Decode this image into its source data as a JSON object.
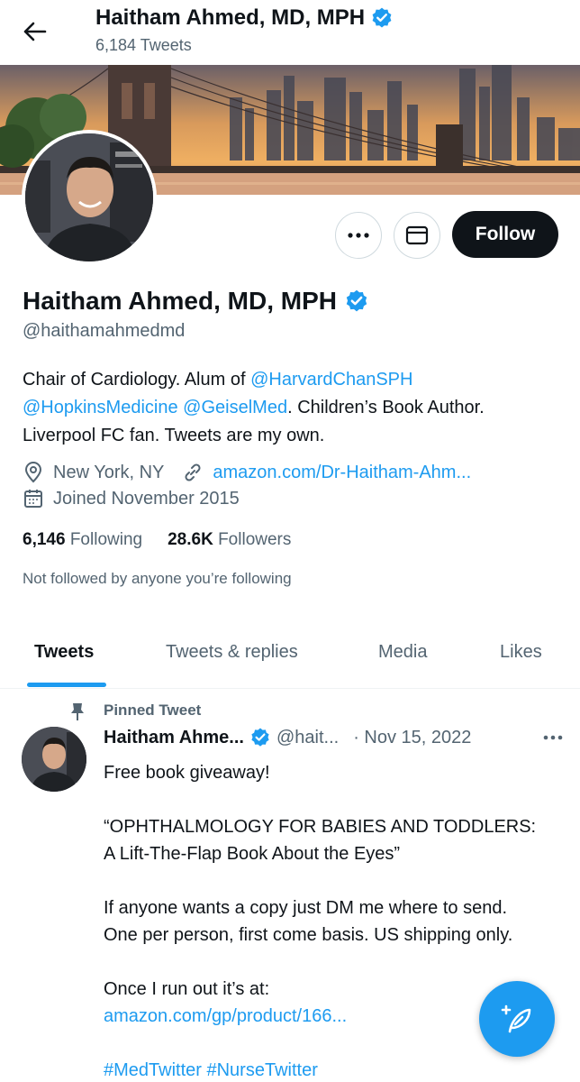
{
  "header": {
    "name": "Haitham Ahmed, MD, MPH",
    "tweet_count": "6,184 Tweets"
  },
  "profile": {
    "name": "Haitham Ahmed, MD, MPH",
    "handle": "@haithamahmedmd",
    "follow_label": "Follow",
    "bio": {
      "part1": "Chair of Cardiology. Alum of ",
      "mention1": "@HarvardChanSPH",
      "mention2": "@HopkinsMedicine",
      "mention3": "@GeiselMed",
      "part2": ". Children’s Book Author.",
      "part3": "Liverpool FC fan. Tweets are my own."
    },
    "location": "New York, NY",
    "website": "amazon.com/Dr-Haitham-Ahm...",
    "joined": "Joined November 2015",
    "following_count": "6,146",
    "following_label": "Following",
    "followers_count": "28.6K",
    "followers_label": "Followers",
    "not_followed": "Not followed by anyone you’re following"
  },
  "tabs": [
    "Tweets",
    "Tweets & replies",
    "Media",
    "Likes"
  ],
  "tweet": {
    "pinned_label": "Pinned Tweet",
    "author": "Haitham Ahme...",
    "handle": "@hait...",
    "date": "· Nov 15, 2022",
    "line1": "Free book giveaway!",
    "line2a": "“OPHTHALMOLOGY FOR BABIES AND TODDLERS:",
    "line2b": "A Lift-The-Flap Book About the Eyes”",
    "line3a": "If anyone wants a copy just DM me where to send.",
    "line3b": "One per person, first come basis. US shipping only.",
    "line4": "Once I run out it’s at:",
    "link": "amazon.com/gp/product/166...",
    "hashtags": "#MedTwitter #NurseTwitter"
  },
  "colors": {
    "accent": "#1d9bf0",
    "text": "#0f1419",
    "secondary": "#536471"
  },
  "icons": [
    "back-arrow-icon",
    "verified-badge-icon",
    "more-icon",
    "mail-icon",
    "location-icon",
    "link-icon",
    "calendar-icon",
    "pin-icon",
    "compose-icon"
  ]
}
